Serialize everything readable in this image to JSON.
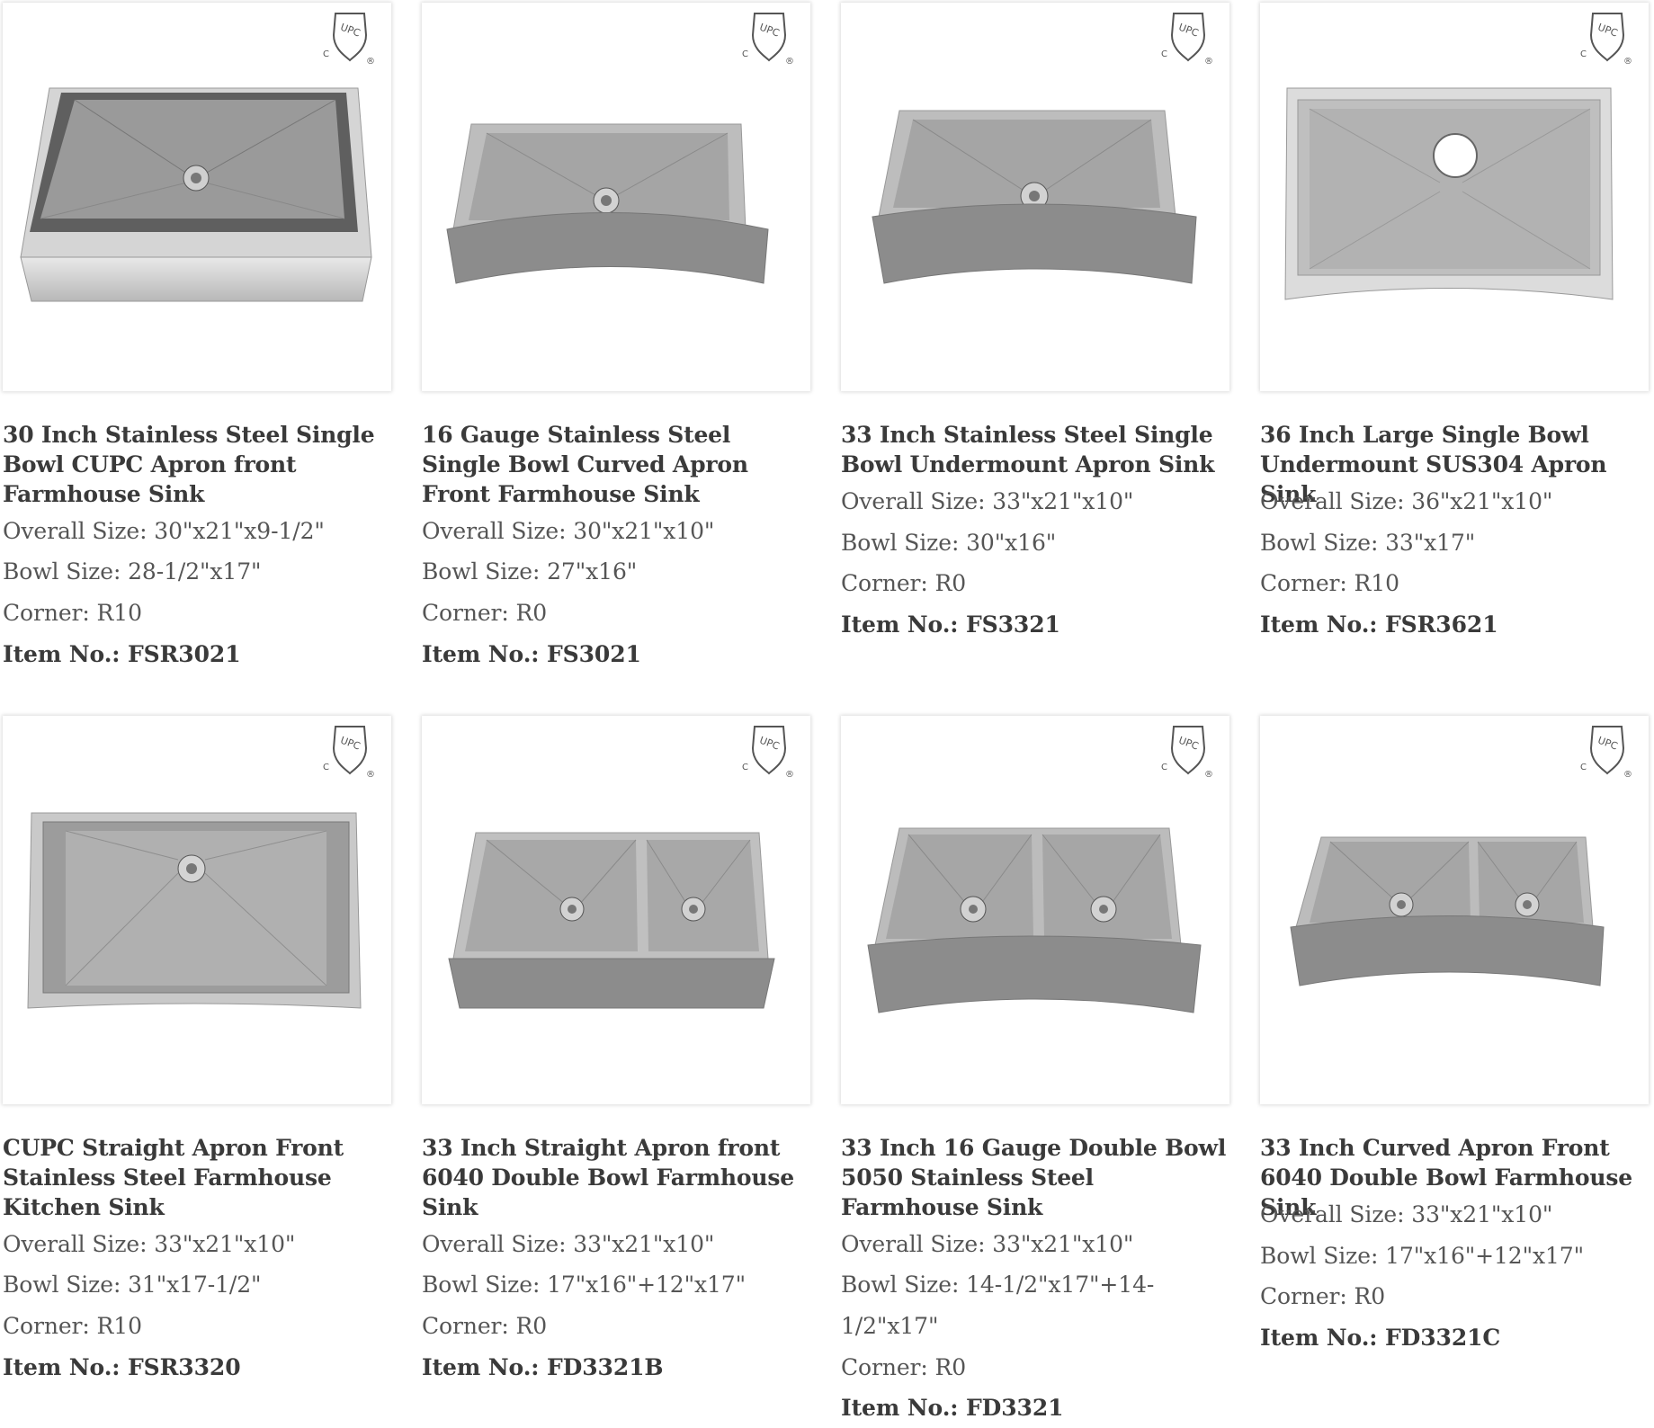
{
  "upc_mark": {
    "text": "UPC",
    "c_letter": "C",
    "registered": "®"
  },
  "products": [
    {
      "title": "30 Inch Stainless Steel Single Bowl CUPC Apron front Farmhouse Sink",
      "specs": [
        "Overall Size: 30\"x21\"x9-1/2\"",
        "Bowl Size: 28-1/2\"x17\"",
        "Corner: R10"
      ],
      "item": "Item No.: FSR3021",
      "image_icon": "single-bowl-straight-apron-sink-photo"
    },
    {
      "title": "16 Gauge Stainless Steel Single Bowl Curved Apron Front Farmhouse Sink",
      "specs": [
        "Overall Size: 30\"x21\"x10\"",
        "Bowl Size: 27\"x16\"",
        "Corner: R0"
      ],
      "item": "Item No.: FS3021",
      "image_icon": "single-bowl-curved-apron-sink-photo"
    },
    {
      "title": "33 Inch Stainless Steel Single Bowl Undermount Apron Sink",
      "specs": [
        "Overall Size: 33\"x21\"x10\"",
        "Bowl Size: 30\"x16\"",
        "Corner: R0"
      ],
      "item": "Item No.: FS3321",
      "image_icon": "single-bowl-curved-apron-sink-photo"
    },
    {
      "title": "36 Inch Large Single Bowl Undermount SUS304 Apron Sink",
      "specs": [
        "Overall Size: 36\"x21\"x10\"",
        "Bowl Size: 33\"x17\"",
        "Corner: R10"
      ],
      "item": "Item No.: FSR3621",
      "image_icon": "single-bowl-top-view-sink-photo"
    },
    {
      "title": "CUPC Straight Apron Front Stainless Steel Farmhouse Kitchen Sink",
      "specs": [
        "Overall Size: 33\"x21\"x10\"",
        "Bowl Size: 31\"x17-1/2\"",
        "Corner: R10"
      ],
      "item": "Item No.: FSR3320",
      "image_icon": "single-bowl-top-view-sink-photo"
    },
    {
      "title": "33 Inch Straight Apron front 6040 Double Bowl Farmhouse Sink",
      "specs": [
        "Overall Size: 33\"x21\"x10\"",
        "Bowl Size: 17\"x16\"+12\"x17\"",
        "Corner: R0"
      ],
      "item": "Item No.: FD3321B",
      "image_icon": "double-bowl-straight-apron-sink-photo"
    },
    {
      "title": "33 Inch 16 Gauge Double Bowl 5050 Stainless Steel Farmhouse Sink",
      "specs": [
        "Overall Size: 33\"x21\"x10\"",
        "Bowl Size: 14-1/2\"x17\"+14-",
        "1/2\"x17\"",
        "Corner: R0"
      ],
      "item": "Item No.: FD3321",
      "image_icon": "double-bowl-curved-apron-sink-photo"
    },
    {
      "title": "33 Inch Curved Apron Front 6040 Double Bowl Farmhouse Sink",
      "specs": [
        "Overall Size: 33\"x21\"x10\"",
        "Bowl Size: 17\"x16\"+12\"x17\"",
        "Corner: R0"
      ],
      "item": "Item No.: FD3321C",
      "image_icon": "double-bowl-curved-apron-sink-photo"
    }
  ]
}
